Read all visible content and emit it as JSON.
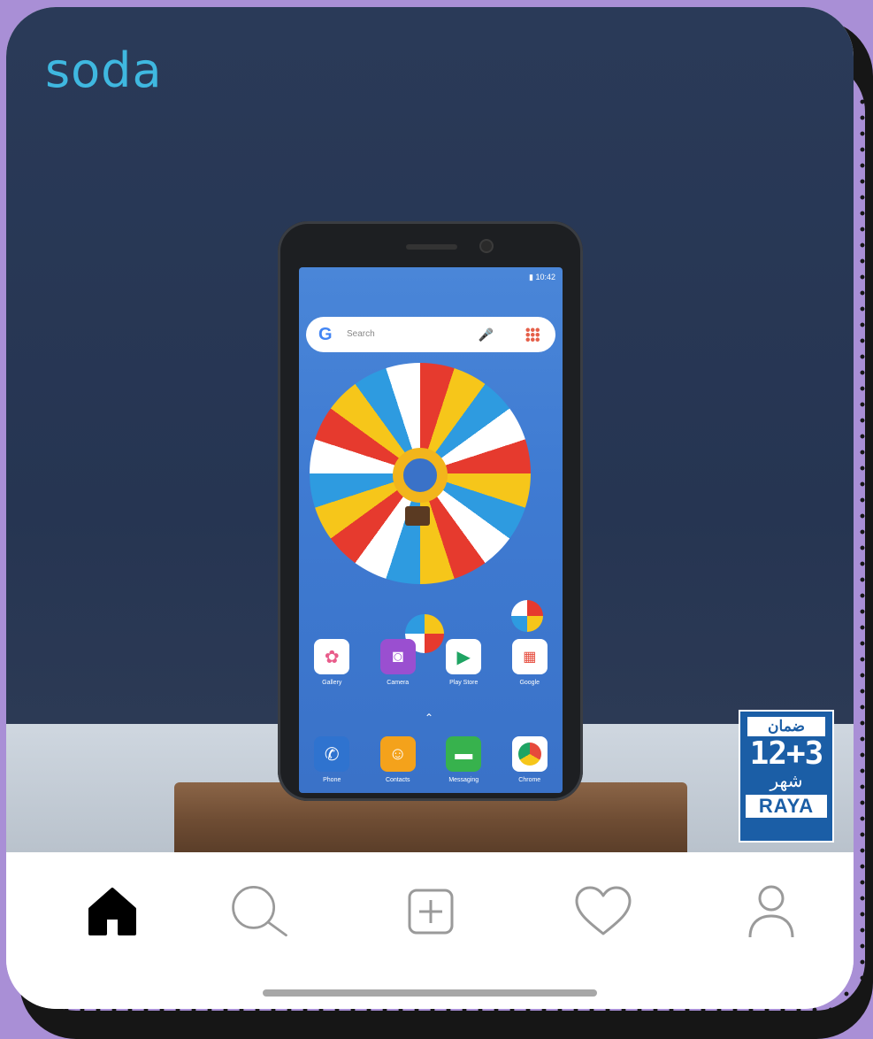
{
  "post": {
    "brand": "soda",
    "phone": {
      "status_time": "10:42",
      "search_placeholder": "Search",
      "google_letter": "G",
      "apps": [
        {
          "label": "Gallery",
          "icon": "gallery-icon",
          "color": "#ffffff"
        },
        {
          "label": "Camera",
          "icon": "camera-icon",
          "color": "#9a4fd0"
        },
        {
          "label": "Play Store",
          "icon": "play-store-icon",
          "color": "#ffffff"
        },
        {
          "label": "Google",
          "icon": "google-folder-icon",
          "color": "#ffffff"
        }
      ],
      "dock": [
        {
          "label": "Phone",
          "icon": "phone-icon",
          "color": "#2f73cf"
        },
        {
          "label": "Contacts",
          "icon": "contacts-icon",
          "color": "#f4a21b"
        },
        {
          "label": "Messaging",
          "icon": "messaging-icon",
          "color": "#37b24d"
        },
        {
          "label": "Chrome",
          "icon": "chrome-icon",
          "color": "#ffffff"
        }
      ]
    },
    "badge": {
      "top": "ضمان",
      "number": "12+3",
      "unit": "شهر",
      "brand": "RAYA"
    }
  },
  "nav": {
    "items": [
      {
        "name": "home",
        "icon": "home-icon",
        "active": true
      },
      {
        "name": "search",
        "icon": "search-icon",
        "active": false
      },
      {
        "name": "create",
        "icon": "add-post-icon",
        "active": false
      },
      {
        "name": "activity",
        "icon": "heart-icon",
        "active": false
      },
      {
        "name": "profile",
        "icon": "profile-icon",
        "active": false
      }
    ]
  },
  "colors": {
    "frame_purple": "#a98fd6",
    "brand_blue": "#3fb8e0",
    "badge_blue": "#1b5ea6",
    "post_background": "#2a3a58"
  }
}
